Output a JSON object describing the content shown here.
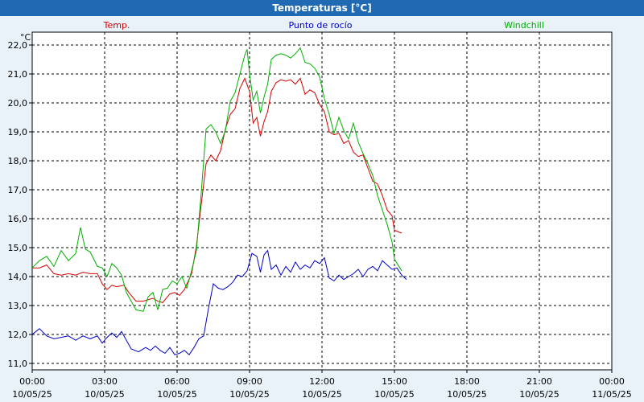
{
  "window": {
    "title": "Temperaturas [°C]"
  },
  "colors": {
    "background": "#e9f1f9",
    "plot_background": "#ffffff",
    "title_bar": "#1f6ab2",
    "grid": "#000000"
  },
  "chart_data": {
    "type": "line",
    "title": "Temperaturas [°C]",
    "ylabel": "°C",
    "ylim": [
      10.8,
      22.2
    ],
    "y_ticks": [
      "22,0",
      "21,0",
      "20,0",
      "19,0",
      "18,0",
      "17,0",
      "16,0",
      "15,0",
      "14,0",
      "13,0",
      "12,0",
      "11,0"
    ],
    "y_tick_values": [
      22,
      21,
      20,
      19,
      18,
      17,
      16,
      15,
      14,
      13,
      12,
      11
    ],
    "x_range_hours": [
      0,
      24
    ],
    "x_ticks": [
      {
        "time": "00:00",
        "date": "10/05/25"
      },
      {
        "time": "03:00",
        "date": "10/05/25"
      },
      {
        "time": "06:00",
        "date": "10/05/25"
      },
      {
        "time": "09:00",
        "date": "10/05/25"
      },
      {
        "time": "12:00",
        "date": "10/05/25"
      },
      {
        "time": "15:00",
        "date": "10/05/25"
      },
      {
        "time": "18:00",
        "date": "10/05/25"
      },
      {
        "time": "21:00",
        "date": "10/05/25"
      },
      {
        "time": "00:00",
        "date": "11/05/25"
      }
    ],
    "grid": true,
    "series": [
      {
        "name": "Temp.",
        "color": "#d40000",
        "points": [
          [
            0,
            14.3
          ],
          [
            0.3,
            14.3
          ],
          [
            0.6,
            14.4
          ],
          [
            0.9,
            14.1
          ],
          [
            1.2,
            14.05
          ],
          [
            1.5,
            14.1
          ],
          [
            1.8,
            14.05
          ],
          [
            2.1,
            14.15
          ],
          [
            2.4,
            14.1
          ],
          [
            2.7,
            14.1
          ],
          [
            2.9,
            13.75
          ],
          [
            3.1,
            13.55
          ],
          [
            3.3,
            13.7
          ],
          [
            3.5,
            13.65
          ],
          [
            3.8,
            13.7
          ],
          [
            4,
            13.45
          ],
          [
            4.3,
            13.15
          ],
          [
            4.6,
            13.15
          ],
          [
            4.8,
            13.2
          ],
          [
            5,
            13.25
          ],
          [
            5.2,
            13.15
          ],
          [
            5.4,
            13.1
          ],
          [
            5.7,
            13.4
          ],
          [
            5.9,
            13.45
          ],
          [
            6.1,
            13.35
          ],
          [
            6.3,
            13.55
          ],
          [
            6.6,
            14.1
          ],
          [
            6.8,
            15.05
          ],
          [
            7,
            16.5
          ],
          [
            7.2,
            17.9
          ],
          [
            7.4,
            18.2
          ],
          [
            7.6,
            18.0
          ],
          [
            7.8,
            18.35
          ],
          [
            8.0,
            19.1
          ],
          [
            8.2,
            19.6
          ],
          [
            8.4,
            19.8
          ],
          [
            8.6,
            20.5
          ],
          [
            8.8,
            20.85
          ],
          [
            9.0,
            20.4
          ],
          [
            9.15,
            19.3
          ],
          [
            9.3,
            19.5
          ],
          [
            9.45,
            18.85
          ],
          [
            9.6,
            19.35
          ],
          [
            9.75,
            19.7
          ],
          [
            9.9,
            20.4
          ],
          [
            10.1,
            20.7
          ],
          [
            10.3,
            20.8
          ],
          [
            10.5,
            20.75
          ],
          [
            10.7,
            20.8
          ],
          [
            10.9,
            20.65
          ],
          [
            11.1,
            20.85
          ],
          [
            11.3,
            20.3
          ],
          [
            11.5,
            20.45
          ],
          [
            11.7,
            20.35
          ],
          [
            11.9,
            19.95
          ],
          [
            12.1,
            19.7
          ],
          [
            12.3,
            19.0
          ],
          [
            12.5,
            18.9
          ],
          [
            12.7,
            18.95
          ],
          [
            12.9,
            18.6
          ],
          [
            13.1,
            18.7
          ],
          [
            13.3,
            18.3
          ],
          [
            13.5,
            18.15
          ],
          [
            13.7,
            18.2
          ],
          [
            13.9,
            17.75
          ],
          [
            14.1,
            17.3
          ],
          [
            14.3,
            17.2
          ],
          [
            14.5,
            16.8
          ],
          [
            14.7,
            16.3
          ],
          [
            14.9,
            16.1
          ],
          [
            15.0,
            15.6
          ],
          [
            15.3,
            15.5
          ]
        ]
      },
      {
        "name": "Punto de rocío",
        "color": "#0000c8",
        "points": [
          [
            0,
            12.0
          ],
          [
            0.3,
            12.2
          ],
          [
            0.6,
            11.95
          ],
          [
            0.9,
            11.85
          ],
          [
            1.2,
            11.9
          ],
          [
            1.5,
            11.95
          ],
          [
            1.8,
            11.8
          ],
          [
            2.1,
            11.95
          ],
          [
            2.4,
            11.85
          ],
          [
            2.7,
            11.95
          ],
          [
            2.9,
            11.7
          ],
          [
            3.1,
            11.9
          ],
          [
            3.3,
            12.05
          ],
          [
            3.5,
            11.9
          ],
          [
            3.7,
            12.1
          ],
          [
            3.9,
            11.8
          ],
          [
            4.1,
            11.5
          ],
          [
            4.4,
            11.4
          ],
          [
            4.7,
            11.55
          ],
          [
            4.9,
            11.45
          ],
          [
            5.1,
            11.6
          ],
          [
            5.3,
            11.45
          ],
          [
            5.5,
            11.35
          ],
          [
            5.7,
            11.55
          ],
          [
            5.9,
            11.3
          ],
          [
            6.1,
            11.35
          ],
          [
            6.3,
            11.45
          ],
          [
            6.5,
            11.3
          ],
          [
            6.7,
            11.55
          ],
          [
            6.9,
            11.85
          ],
          [
            7.1,
            11.95
          ],
          [
            7.3,
            12.9
          ],
          [
            7.5,
            13.75
          ],
          [
            7.7,
            13.6
          ],
          [
            7.9,
            13.55
          ],
          [
            8.1,
            13.65
          ],
          [
            8.3,
            13.8
          ],
          [
            8.5,
            14.05
          ],
          [
            8.7,
            14.0
          ],
          [
            8.9,
            14.2
          ],
          [
            9.1,
            14.8
          ],
          [
            9.3,
            14.7
          ],
          [
            9.45,
            14.15
          ],
          [
            9.6,
            14.75
          ],
          [
            9.75,
            14.9
          ],
          [
            9.9,
            14.25
          ],
          [
            10.1,
            14.4
          ],
          [
            10.3,
            14.05
          ],
          [
            10.5,
            14.35
          ],
          [
            10.7,
            14.15
          ],
          [
            10.9,
            14.5
          ],
          [
            11.1,
            14.25
          ],
          [
            11.3,
            14.4
          ],
          [
            11.5,
            14.3
          ],
          [
            11.7,
            14.55
          ],
          [
            11.9,
            14.45
          ],
          [
            12.1,
            14.65
          ],
          [
            12.3,
            13.95
          ],
          [
            12.5,
            13.85
          ],
          [
            12.7,
            14.05
          ],
          [
            12.9,
            13.9
          ],
          [
            13.1,
            14.0
          ],
          [
            13.3,
            14.1
          ],
          [
            13.5,
            14.25
          ],
          [
            13.7,
            14.0
          ],
          [
            13.9,
            14.25
          ],
          [
            14.1,
            14.35
          ],
          [
            14.3,
            14.2
          ],
          [
            14.5,
            14.55
          ],
          [
            14.7,
            14.4
          ],
          [
            14.9,
            14.25
          ],
          [
            15.1,
            14.3
          ],
          [
            15.3,
            14.05
          ],
          [
            15.5,
            13.9
          ]
        ]
      },
      {
        "name": "Windchill",
        "color": "#00b000",
        "points": [
          [
            0,
            14.3
          ],
          [
            0.3,
            14.55
          ],
          [
            0.6,
            14.7
          ],
          [
            0.9,
            14.35
          ],
          [
            1.2,
            14.9
          ],
          [
            1.5,
            14.55
          ],
          [
            1.8,
            14.8
          ],
          [
            2.0,
            15.7
          ],
          [
            2.2,
            14.95
          ],
          [
            2.4,
            14.85
          ],
          [
            2.7,
            14.35
          ],
          [
            2.9,
            14.3
          ],
          [
            3.1,
            14.0
          ],
          [
            3.3,
            14.45
          ],
          [
            3.5,
            14.3
          ],
          [
            3.7,
            14.05
          ],
          [
            3.9,
            13.45
          ],
          [
            4.1,
            13.15
          ],
          [
            4.3,
            12.85
          ],
          [
            4.6,
            12.8
          ],
          [
            4.8,
            13.3
          ],
          [
            5.0,
            13.45
          ],
          [
            5.2,
            12.85
          ],
          [
            5.4,
            13.55
          ],
          [
            5.6,
            13.6
          ],
          [
            5.8,
            13.85
          ],
          [
            6.0,
            13.75
          ],
          [
            6.2,
            14.0
          ],
          [
            6.4,
            13.6
          ],
          [
            6.6,
            14.2
          ],
          [
            6.8,
            14.9
          ],
          [
            7.0,
            16.9
          ],
          [
            7.2,
            19.1
          ],
          [
            7.4,
            19.25
          ],
          [
            7.6,
            19.0
          ],
          [
            7.8,
            18.6
          ],
          [
            8.0,
            19.05
          ],
          [
            8.2,
            20.05
          ],
          [
            8.4,
            20.35
          ],
          [
            8.6,
            21.0
          ],
          [
            8.8,
            21.65
          ],
          [
            8.9,
            21.85
          ],
          [
            9.0,
            21.0
          ],
          [
            9.15,
            20.1
          ],
          [
            9.3,
            20.4
          ],
          [
            9.45,
            19.65
          ],
          [
            9.6,
            20.2
          ],
          [
            9.75,
            20.65
          ],
          [
            9.9,
            21.5
          ],
          [
            10.1,
            21.65
          ],
          [
            10.3,
            21.7
          ],
          [
            10.5,
            21.65
          ],
          [
            10.7,
            21.55
          ],
          [
            10.9,
            21.7
          ],
          [
            11.1,
            21.9
          ],
          [
            11.3,
            21.4
          ],
          [
            11.5,
            21.35
          ],
          [
            11.7,
            21.2
          ],
          [
            11.9,
            20.9
          ],
          [
            12.1,
            20.15
          ],
          [
            12.3,
            19.6
          ],
          [
            12.5,
            18.95
          ],
          [
            12.7,
            19.5
          ],
          [
            12.9,
            19.05
          ],
          [
            13.1,
            18.75
          ],
          [
            13.3,
            19.3
          ],
          [
            13.5,
            18.65
          ],
          [
            13.7,
            18.25
          ],
          [
            13.9,
            17.9
          ],
          [
            14.1,
            17.5
          ],
          [
            14.3,
            16.8
          ],
          [
            14.5,
            16.3
          ],
          [
            14.7,
            15.8
          ],
          [
            14.9,
            15.2
          ],
          [
            15.0,
            14.6
          ],
          [
            15.3,
            14.2
          ]
        ]
      }
    ]
  }
}
